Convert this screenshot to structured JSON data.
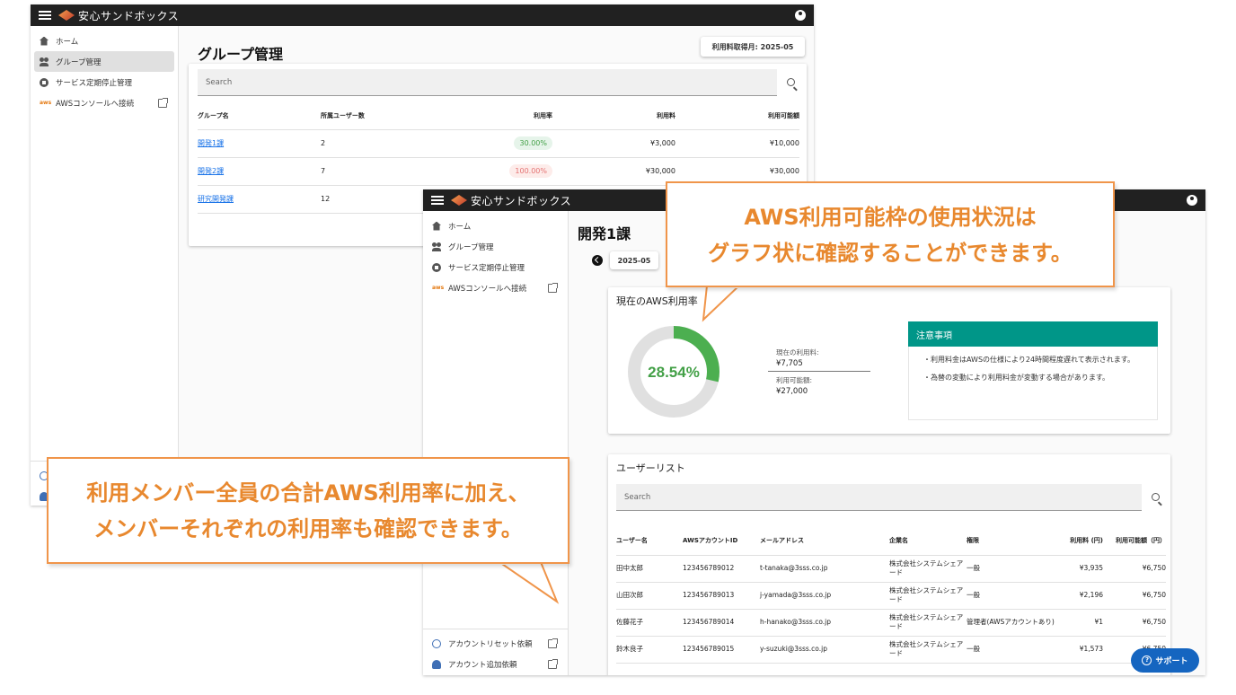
{
  "app": {
    "title": "安心サンドボックス"
  },
  "sidebar": {
    "items": [
      {
        "label": "ホーム",
        "icon": "home-icon"
      },
      {
        "label": "グループ管理",
        "icon": "group-icon"
      },
      {
        "label": "サービス定期停止管理",
        "icon": "stop-circle-icon"
      },
      {
        "label": "AWSコンソールへ接続",
        "icon": "aws-icon"
      }
    ],
    "aws_icon_text": "aws",
    "bottom_items": [
      {
        "label": "アカウントリセット依頼",
        "icon": "account-circle-icon"
      },
      {
        "label": "アカウント追加依頼",
        "icon": "person-add-icon"
      }
    ]
  },
  "group_page": {
    "title": "グループ管理",
    "billing_month": "利用料取得月: 2025-05",
    "search_placeholder": "Search",
    "columns": [
      "グループ名",
      "所属ユーザー数",
      "利用率",
      "利用料",
      "利用可能額"
    ],
    "rows": [
      {
        "name": "開発1課",
        "users": "2",
        "rate": "30.00%",
        "rate_status": "ok",
        "cost": "¥3,000",
        "limit": "¥10,000"
      },
      {
        "name": "開発2課",
        "users": "7",
        "rate": "100.00%",
        "rate_status": "over",
        "cost": "¥30,000",
        "limit": "¥30,000"
      },
      {
        "name": "研究開発課",
        "users": "12",
        "rate": "",
        "rate_status": "",
        "cost": "",
        "limit": ""
      }
    ]
  },
  "detail_page": {
    "title": "開発1課",
    "month": "2025-05",
    "usage_card": {
      "title": "現在のAWS利用率",
      "percent": "28.54%",
      "fraction": 0.2854,
      "current_label": "現在の利用料:",
      "current_value": "¥7,705",
      "limit_label": "利用可能額:",
      "limit_value": "¥27,000",
      "ring_color": "#4caf50",
      "ring_track": "#e0e0e0"
    },
    "notice": {
      "title": "注意事項",
      "lines": [
        "・利用料金はAWSの仕様により24時間程度遅れて表示されます。",
        "・為替の変動により利用料金が変動する場合があります。"
      ]
    },
    "user_list": {
      "title": "ユーザーリスト",
      "search_placeholder": "Search",
      "columns": [
        "ユーザー名",
        "AWSアカウントID",
        "メールアドレス",
        "企業名",
        "権限",
        "利用料 (円)",
        "利用可能額（円）"
      ],
      "rows": [
        {
          "name": "田中太郎",
          "id": "123456789012",
          "email": "t-tanaka@3sss.co.jp",
          "company": "株式会社システムシェアード",
          "role": "一般",
          "cost": "¥3,935",
          "limit": "¥6,750"
        },
        {
          "name": "山田次郎",
          "id": "123456789013",
          "email": "j-yamada@3sss.co.jp",
          "company": "株式会社システムシェアード",
          "role": "一般",
          "cost": "¥2,196",
          "limit": "¥6,750"
        },
        {
          "name": "佐藤花子",
          "id": "123456789014",
          "email": "h-hanako@3sss.co.jp",
          "company": "株式会社システムシェアード",
          "role": "管理者(AWSアカウントあり)",
          "cost": "¥1",
          "limit": "¥6,750"
        },
        {
          "name": "鈴木良子",
          "id": "123456789015",
          "email": "y-suzuki@3sss.co.jp",
          "company": "株式会社システムシェアード",
          "role": "一般",
          "cost": "¥1,573",
          "limit": "¥6,750"
        }
      ]
    }
  },
  "callouts": {
    "top": [
      "AWS利用可能枠の使用状況は",
      "グラフ状に確認することができます。"
    ],
    "bottom": [
      "利用メンバー全員の合計AWS利用率に加え、",
      "メンバーそれぞれの利用率も確認できます。"
    ],
    "border_color": "#f0954a",
    "text_color": "#e8882e"
  },
  "support_button": {
    "label": "サポート"
  }
}
